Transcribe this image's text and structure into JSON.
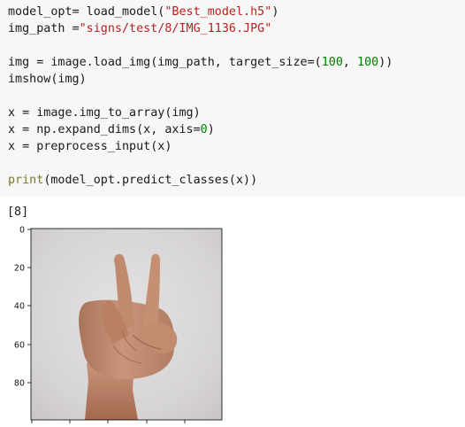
{
  "code_lines": [
    [
      {
        "t": "model_opt= load_model(",
        "c": "default"
      },
      {
        "t": "\"Best_model.h5\"",
        "c": "string"
      },
      {
        "t": ")",
        "c": "default"
      }
    ],
    [
      {
        "t": "img_path =",
        "c": "default"
      },
      {
        "t": "\"signs/test/8/IMG_1136.JPG\"",
        "c": "string"
      }
    ],
    [],
    [
      {
        "t": "img = image.load_img(img_path, target_size=(",
        "c": "default"
      },
      {
        "t": "100",
        "c": "number"
      },
      {
        "t": ", ",
        "c": "default"
      },
      {
        "t": "100",
        "c": "number"
      },
      {
        "t": "))",
        "c": "default"
      }
    ],
    [
      {
        "t": "imshow(img)",
        "c": "default"
      }
    ],
    [],
    [
      {
        "t": "x = image.img_to_array(img)",
        "c": "default"
      }
    ],
    [
      {
        "t": "x = np.expand_dims(x, axis=",
        "c": "default"
      },
      {
        "t": "0",
        "c": "number"
      },
      {
        "t": ")",
        "c": "default"
      }
    ],
    [
      {
        "t": "x = preprocess_input(x)",
        "c": "default"
      }
    ],
    [],
    [
      {
        "t": "print",
        "c": "builtin"
      },
      {
        "t": "(model_opt.predict_classes(x))",
        "c": "default"
      }
    ]
  ],
  "colors": {
    "default": "#1a1a1a",
    "string": "#ba2121",
    "number": "#008000",
    "builtin": "#7a7a2a",
    "cell_bg": "#f7f7f7"
  },
  "output": {
    "text": "[8]"
  },
  "image_plot": {
    "y_ticks": [
      "0",
      "20",
      "40",
      "60",
      "80"
    ],
    "x_tick_count": 5,
    "content": "hand showing sign with index and middle fingers raised"
  }
}
